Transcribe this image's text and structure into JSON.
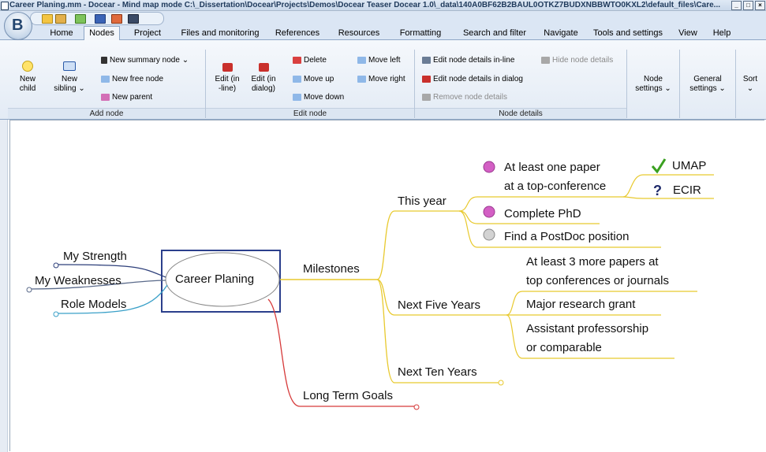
{
  "window": {
    "title": "Career Planing.mm - Docear - Mind map mode C:\\_Dissertation\\Docear\\Projects\\Demos\\Docear Teaser Docear 1.0\\_data\\140A0BF62B2BAUL0OTKZ7BUDXNBBWTO0KXL2\\default_files\\Care...",
    "minimize_label": "_",
    "maximize_label": "□",
    "close_label": "×"
  },
  "tabs": [
    {
      "label": "Home"
    },
    {
      "label": "Nodes"
    },
    {
      "label": "Project"
    },
    {
      "label": "Files and monitoring"
    },
    {
      "label": "References"
    },
    {
      "label": "Resources"
    },
    {
      "label": "Formatting"
    },
    {
      "label": "Search and filter"
    },
    {
      "label": "Navigate"
    },
    {
      "label": "Tools and settings"
    },
    {
      "label": "View"
    },
    {
      "label": "Help"
    }
  ],
  "ribbon": {
    "add_node": {
      "group_label": "Add node",
      "new_child_line1": "New",
      "new_child_line2": "child",
      "new_sibling_line1": "New",
      "new_sibling_line2": "sibling ⌄",
      "new_summary": "New summary node  ⌄",
      "new_free": "New free node",
      "new_parent": "New parent"
    },
    "edit_node": {
      "group_label": "Edit node",
      "edit_inline_line1": "Edit (in",
      "edit_inline_line2": "-line)",
      "edit_dialog_line1": "Edit (in",
      "edit_dialog_line2": "dialog)",
      "delete": "Delete",
      "move_up": "Move up",
      "move_down": "Move down",
      "move_left": "Move left",
      "move_right": "Move right"
    },
    "node_details": {
      "group_label": "Node details",
      "edit_inline": "Edit node details in-line",
      "edit_dialog": "Edit node details in dialog",
      "remove": "Remove node details",
      "hide": "Hide node details"
    },
    "node_settings_line1": "Node",
    "node_settings_line2": "settings ⌄",
    "general_settings_line1": "General",
    "general_settings_line2": "settings ⌄",
    "sort_line1": "Sort",
    "sort_line2": "⌄"
  },
  "mindmap": {
    "root": "Career Planing",
    "left": [
      "My Strength",
      "My Weaknesses",
      "Role Models"
    ],
    "milestones": "Milestones",
    "this_year": "This year",
    "paper_line1": "At least one paper",
    "paper_line2": "at a top-conference",
    "umap": "UMAP",
    "ecir": "ECIR",
    "complete_phd": "Complete PhD",
    "postdoc": "Find a PostDoc position",
    "next_five": "Next Five Years",
    "papers_line1": "At least 3 more papers at",
    "papers_line2": "top conferences or journals",
    "grant": "Major research grant",
    "prof_line1": "Assistant professorship",
    "prof_line2": "or comparable",
    "next_ten": "Next Ten Years",
    "long_term": "Long Term Goals"
  },
  "colors": {
    "ribbon_bg": "#e3ebf5",
    "edge_yellow": "#e8c92e",
    "edge_red": "#d63a3a",
    "edge_blue_dark": "#2d3f7a",
    "edge_teal": "#3aa0c8",
    "edge_slate": "#5a6a8a",
    "root_border": "#2b3f8c"
  },
  "icons": {
    "umap": "checkmark-icon",
    "ecir": "question-icon",
    "paper": "pink-ball-icon",
    "phd": "pink-ball-icon",
    "postdoc": "grey-ball-icon"
  }
}
